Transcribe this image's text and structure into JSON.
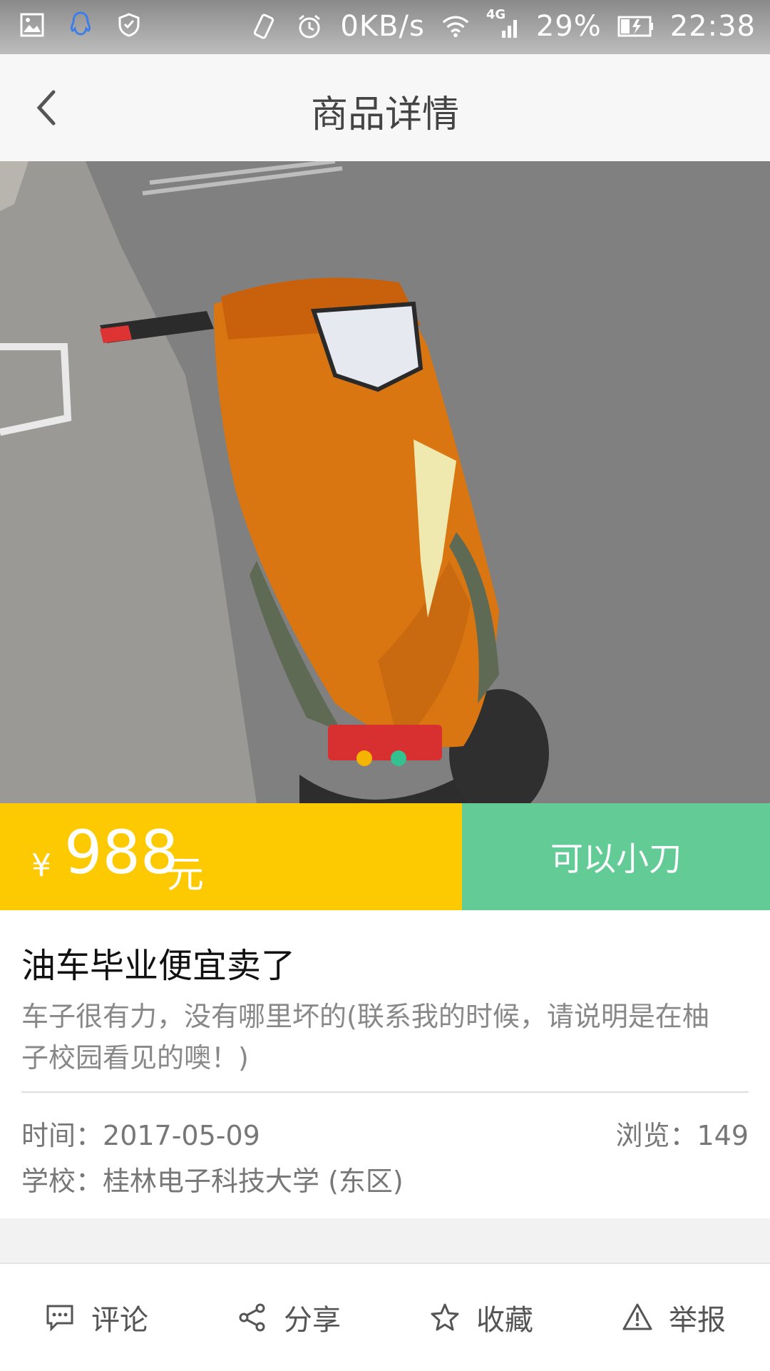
{
  "status_bar": {
    "net_speed": "0KB/s",
    "network": "4G",
    "battery": "29%",
    "time": "22:38"
  },
  "nav": {
    "title": "商品详情"
  },
  "gallery": {
    "image_description": "Orange motor scooter parked on asphalt",
    "pages": 2,
    "active_page": 1,
    "dot_colors": [
      "#f5b400",
      "#33c18f"
    ]
  },
  "price": {
    "currency_symbol": "¥",
    "amount": "988",
    "unit": "元",
    "bargain_label": "可以小刀"
  },
  "item": {
    "title": "油车毕业便宜卖了",
    "description": "车子很有力，没有哪里坏的(联系我的时候，请说明是在柚子校园看见的噢！)",
    "time_label": "时间：",
    "time_value": "2017-05-09",
    "school_label": "学校：",
    "school_value": "桂林电子科技大学 (东区)",
    "views_label": "浏览：",
    "views_value": "149"
  },
  "toolbar": {
    "comment": "评论",
    "share": "分享",
    "favorite": "收藏",
    "report": "举报"
  },
  "colors": {
    "price_bg": "#fdc900",
    "bargain_bg": "#63cc96"
  }
}
